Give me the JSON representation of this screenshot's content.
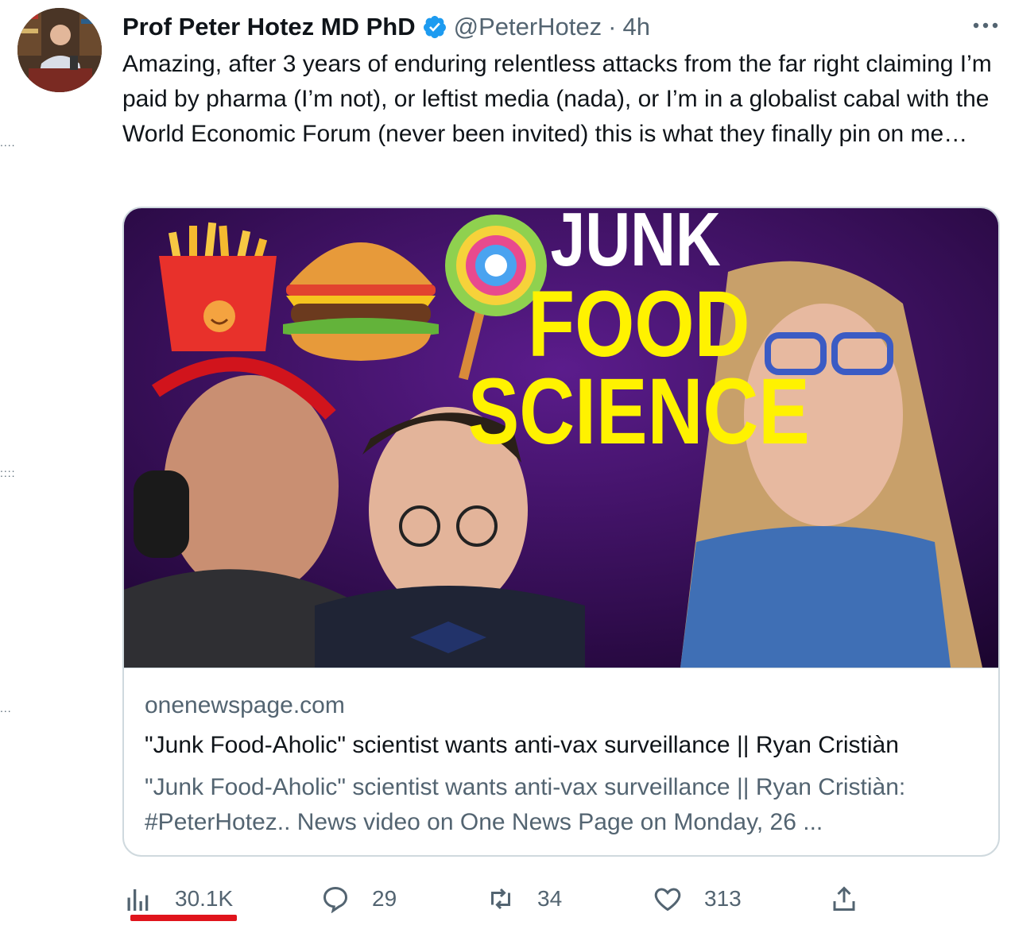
{
  "tweet": {
    "author_name": "Prof Peter Hotez MD PhD",
    "handle": "@PeterHotez",
    "separator": "·",
    "time": "4h",
    "text": "Amazing, after 3 years of enduring relentless attacks from the far right claiming I’m paid by pharma (I’m not), or leftist media (nada), or I’m in a globalist cabal with the World Economic Forum (never been invited) this is what they finally pin on me…"
  },
  "card": {
    "image_text": {
      "line1": "JUNK",
      "line2": "FOOD",
      "line3": "SCIENCE"
    },
    "domain": "onenewspage.com",
    "title": "\"Junk Food-Aholic\" scientist wants anti-vax surveillance || Ryan Cristiàn",
    "description": "\"Junk Food-Aholic\" scientist wants anti-vax surveillance || Ryan Cristiàn: #PeterHotez.. News video on One News Page on Monday, 26 ..."
  },
  "actions": {
    "views": "30.1K",
    "replies": "29",
    "retweets": "34",
    "likes": "313"
  },
  "icons": {
    "verified": "verified-badge-icon",
    "more": "more-icon",
    "views": "bar-chart-icon",
    "reply": "reply-icon",
    "retweet": "retweet-icon",
    "like": "heart-icon",
    "share": "share-icon"
  },
  "colors": {
    "accent": "#1d9bf0",
    "secondary_text": "#536471",
    "highlight_underline": "#e0141c",
    "image_background": "#3b0a5e",
    "headline_yellow": "#fff200"
  }
}
